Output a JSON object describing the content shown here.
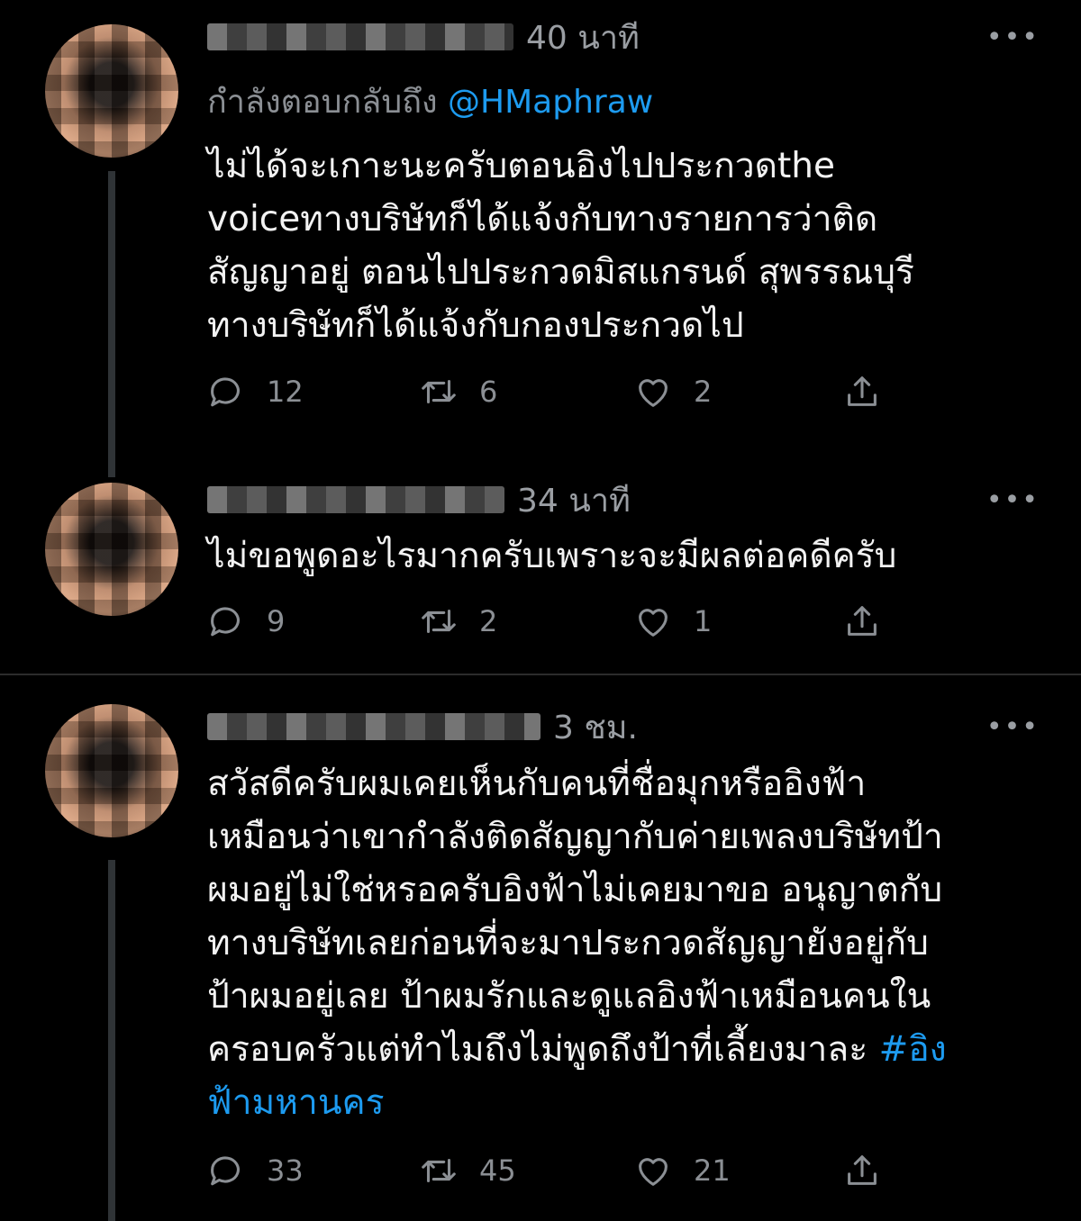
{
  "tweets": [
    {
      "time": "40 นาที",
      "reply_prefix": "กำลังตอบกลับถึง",
      "reply_handle": "@HMaphraw",
      "text": "ไม่ได้จะเกาะนะครับตอนอิงไปประกวดthe\nvoiceทางบริษัทก็ได้แจ้งกับทางรายการว่าติด\nสัญญาอยู่ ตอนไปประกวดมิสแกรนด์ สุพรรณบุรี\nทางบริษัทก็ได้แจ้งกับกองประกวดไป",
      "replies": "12",
      "retweets": "6",
      "likes": "2"
    },
    {
      "time": "34 นาที",
      "text": "ไม่ขอพูดอะไรมากครับเพราะจะมีผลต่อคดีครับ",
      "replies": "9",
      "retweets": "2",
      "likes": "1"
    },
    {
      "time": "3 ชม.",
      "text": "สวัสดีครับผมเคยเห็นกับคนที่ชื่อมุกหรืออิงฟ้า\nเหมือนว่าเขากำลังติดสัญญากับค่ายเพลงบริษัทป้า\nผมอยู่ไม่ใช่หรอครับอิงฟ้าไม่เคยมาขอ อนุญาตกับ\nทางบริษัทเลยก่อนที่จะมาประกวดสัญญายังอยู่กับ\nป้าผมอยู่เลย ป้าผมรักและดูแลอิงฟ้าเหมือนคนใน\nครอบครัวแต่ทำไมถึงไม่พูดถึงป้าที่เลี้ยงมาละ ",
      "hashtag": "#อิง\nฟ้ามหานคร",
      "replies": "33",
      "retweets": "45",
      "likes": "21"
    }
  ],
  "colors": {
    "background": "#000000",
    "text": "#f2f2f2",
    "muted": "#8b8f94",
    "link": "#1d9bf0"
  },
  "icons": [
    "more-icon",
    "reply-icon",
    "retweet-icon",
    "like-icon",
    "share-icon"
  ]
}
